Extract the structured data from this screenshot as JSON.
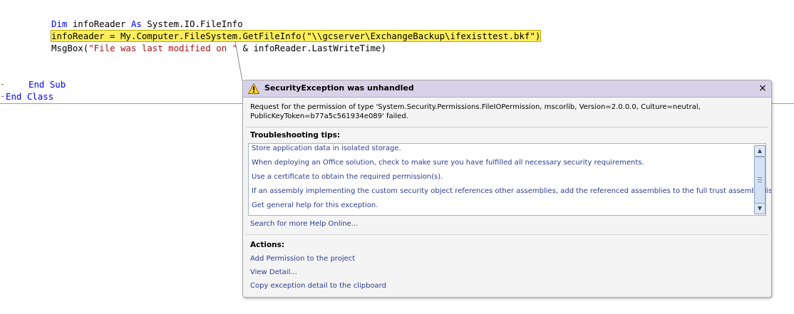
{
  "editor": {
    "line1": {
      "kw1": "Dim",
      "text1": " infoReader ",
      "kw2": "As",
      "text2": " System.IO.FileInfo"
    },
    "line2": {
      "text1": "infoReader = My.Computer.FileSystem.GetFileInfo(",
      "str": "\"\\\\gcserver\\ExchangeBackup\\ifexisttest.bkf\"",
      "text2": ")"
    },
    "line3": {
      "text1": "MsgBox(",
      "str": "\"File was last modified on \"",
      "text2": " & infoReader.LastWriteTime)"
    },
    "line4": {
      "kw": "End Sub"
    },
    "line5": {
      "kw": "End Class"
    },
    "outline_marks": [
      "-",
      "-"
    ],
    "highlight_color": "#ffef5c"
  },
  "exception": {
    "title": "SecurityException was unhandled",
    "close_glyph": "×",
    "icon": "warning-icon",
    "message": "Request for the permission of type 'System.Security.Permissions.FileIOPermission, mscorlib, Version=2.0.0.0, Culture=neutral, PublicKeyToken=b77a5c561934e089' failed.",
    "tips_heading": "Troubleshooting tips:",
    "tips": [
      "Store application data in isolated storage.",
      "When deploying an Office solution, check to make sure you have fulfilled all necessary security requirements.",
      "Use a certificate to obtain the required permission(s).",
      "If an assembly implementing the custom security object references other assemblies, add the referenced assemblies to the full trust assembly list.",
      "Get general help for this exception."
    ],
    "search_link": "Search for more Help Online...",
    "actions_heading": "Actions:",
    "actions": [
      "Add Permission to the project",
      "View Detail...",
      "Copy exception detail to the clipboard"
    ],
    "header_color": "#d8d2e8",
    "link_color": "#2b3c8f"
  }
}
